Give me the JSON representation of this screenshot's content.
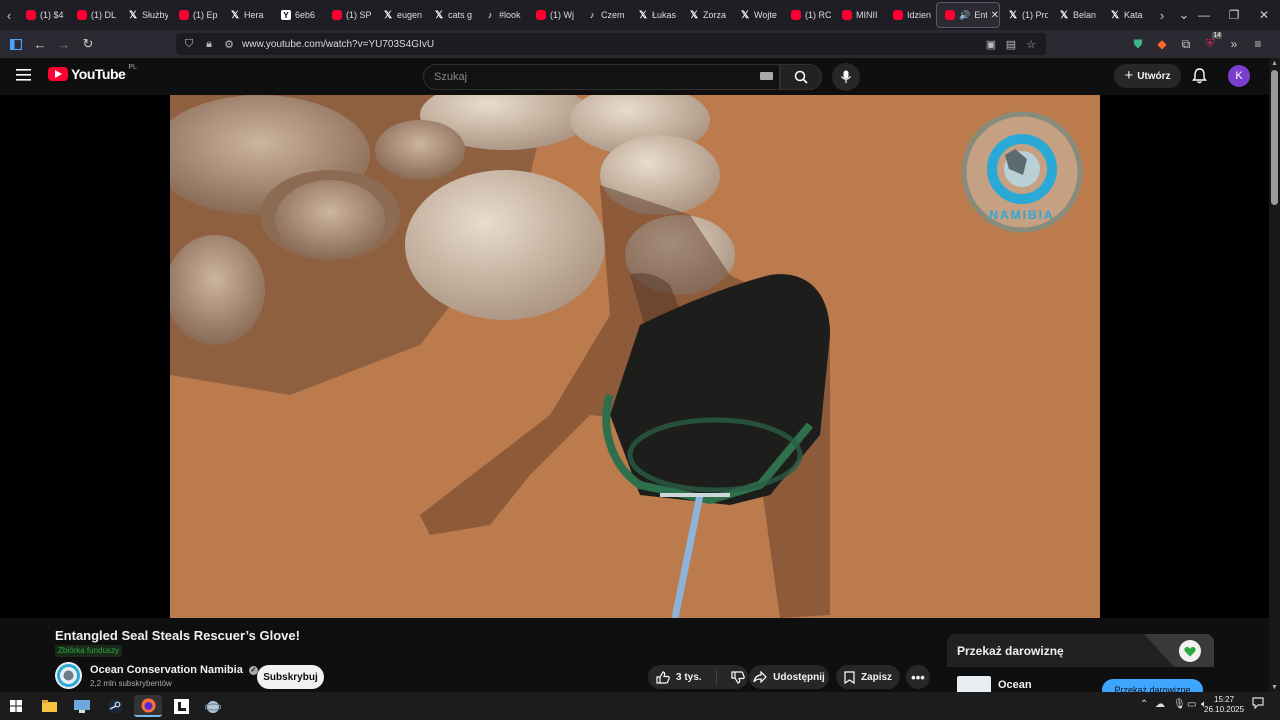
{
  "browser": {
    "tabs": [
      {
        "icon": "youtube",
        "label": "(1) $4"
      },
      {
        "icon": "youtube",
        "label": "(1) DL"
      },
      {
        "icon": "x",
        "label": "Służby"
      },
      {
        "icon": "youtube",
        "label": "(1) Ep"
      },
      {
        "icon": "x",
        "label": "Hera"
      },
      {
        "icon": "ycombinator",
        "label": "6eb6"
      },
      {
        "icon": "youtube",
        "label": "(1) SP"
      },
      {
        "icon": "x",
        "label": "eugen"
      },
      {
        "icon": "x",
        "label": "cats g"
      },
      {
        "icon": "tiktok",
        "label": "#look"
      },
      {
        "icon": "youtube",
        "label": "(1) Wj"
      },
      {
        "icon": "tiktok",
        "label": "Czem"
      },
      {
        "icon": "x",
        "label": "Łukas"
      },
      {
        "icon": "x",
        "label": "Zorza"
      },
      {
        "icon": "x",
        "label": "Wojte"
      },
      {
        "icon": "youtube",
        "label": "(1) RC"
      },
      {
        "icon": "youtube",
        "label": "MINII"
      },
      {
        "icon": "youtube",
        "label": "Idzien"
      }
    ],
    "active_tab": {
      "label": "Ent"
    },
    "tabs_after": [
      {
        "icon": "x",
        "label": "(1) Pro"
      },
      {
        "icon": "x",
        "label": "Belan"
      },
      {
        "icon": "x",
        "label": "Kata"
      }
    ],
    "url": "www.youtube.com/watch?v=YU703S4GIvU",
    "extension_badge": "14"
  },
  "youtube": {
    "logo_text": "YouTube",
    "region": "PL",
    "search_placeholder": "Szukaj",
    "create_label": "Utwórz",
    "avatar_letter": "K"
  },
  "video": {
    "title": "Entangled Seal Steals Rescuer’s Glove!",
    "fundraiser_badge": "Zbiórka funduszy",
    "watermark_text": "OCEAN CONSERVATION NAMIBIA"
  },
  "channel": {
    "name": "Ocean Conservation Namibia",
    "subscribers": "2,2 mln subskrybentów",
    "subscribe_label": "Subskrybuj"
  },
  "actions": {
    "like_count": "3 tys.",
    "share_label": "Udostępnij",
    "save_label": "Zapisz"
  },
  "donation": {
    "title": "Przekaż darowiznę",
    "channel_short": "Ocean",
    "button_label": "Przekaż darowiznę"
  },
  "taskbar": {
    "time": "15:27",
    "date": "26.10.2025"
  },
  "colors": {
    "accent_red": "#ff0033",
    "donate_blue": "#3ea6ff",
    "fund_green": "#2ba640"
  }
}
